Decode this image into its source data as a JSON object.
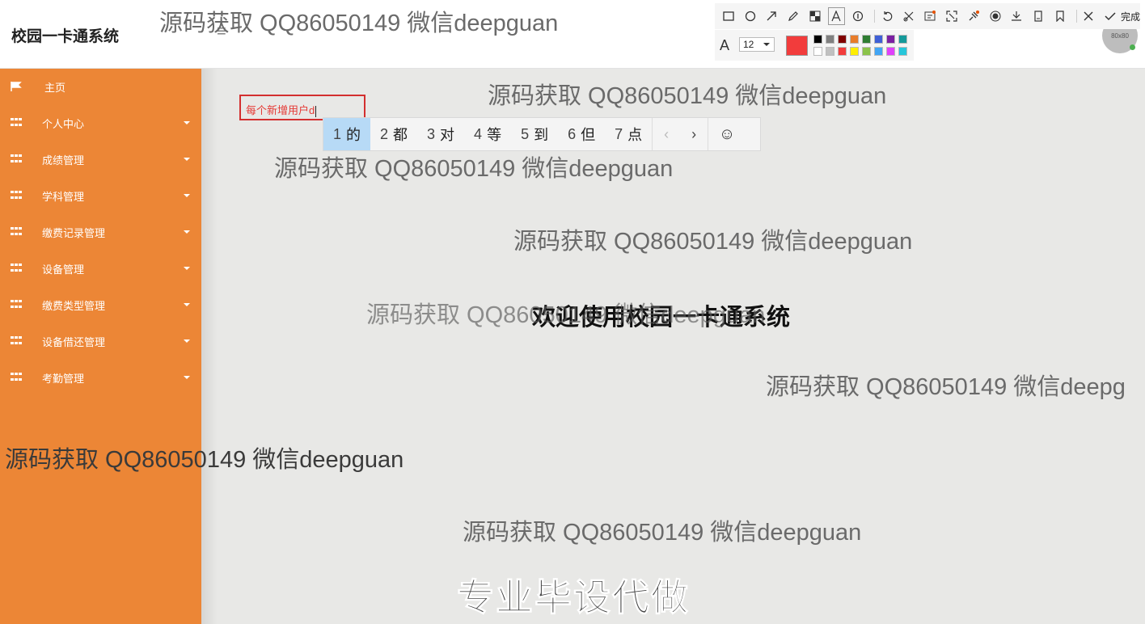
{
  "header": {
    "app_title": "校园一卡通系统",
    "menu_toggle": "≡",
    "avatar_text": "80x80"
  },
  "sidebar": {
    "items": [
      {
        "label": "主页",
        "icon": "flag-icon",
        "has_caret": false
      },
      {
        "label": "个人中心",
        "icon": "grid-icon",
        "has_caret": true
      },
      {
        "label": "成绩管理",
        "icon": "grid-icon",
        "has_caret": true
      },
      {
        "label": "学科管理",
        "icon": "grid-icon",
        "has_caret": true
      },
      {
        "label": "缴费记录管理",
        "icon": "grid-icon",
        "has_caret": true
      },
      {
        "label": "设备管理",
        "icon": "grid-icon",
        "has_caret": true
      },
      {
        "label": "缴费类型管理",
        "icon": "grid-icon",
        "has_caret": true
      },
      {
        "label": "设备借还管理",
        "icon": "grid-icon",
        "has_caret": true
      },
      {
        "label": "考勤管理",
        "icon": "grid-icon",
        "has_caret": true
      }
    ]
  },
  "main": {
    "welcome": "欢迎使用校园一卡通系统",
    "watermark": "源码获取 QQ86050149 微信deepguan",
    "watermark_cut": "源码获取 QQ86050149 微信deepg",
    "promo": "专业毕设代做"
  },
  "annotation": {
    "text": "每个新增用户d",
    "border_color": "#d32f2f"
  },
  "ime": {
    "candidates": [
      {
        "num": "1",
        "text": "的"
      },
      {
        "num": "2",
        "text": "都"
      },
      {
        "num": "3",
        "text": "对"
      },
      {
        "num": "4",
        "text": "等"
      },
      {
        "num": "5",
        "text": "到"
      },
      {
        "num": "6",
        "text": "但"
      },
      {
        "num": "7",
        "text": "点"
      }
    ],
    "prev": "‹",
    "next": "›",
    "emoji": "☺"
  },
  "screenshot_tool": {
    "tools": [
      "rectangle-icon",
      "ellipse-icon",
      "arrow-icon",
      "pencil-icon",
      "mosaic-icon",
      "text-icon",
      "number-icon",
      "undo-icon",
      "delete-icon",
      "ocr-icon",
      "translate-icon",
      "pin-icon",
      "record-icon",
      "download-icon",
      "save-icon",
      "bookmark-icon",
      "close-icon",
      "done-icon"
    ],
    "done_label": "完成",
    "font_size": "12",
    "current_color": "#f23c3c",
    "palette_top": [
      "#000000",
      "#808080",
      "#800000",
      "#e87c2a",
      "#2e7d32",
      "#3f5fd6",
      "#7b1fa2",
      "#14999a"
    ],
    "palette_bottom": [
      "#ffffff",
      "#c0c0c0",
      "#f23c3c",
      "#ffee00",
      "#8bc34a",
      "#42a5f5",
      "#e040fb",
      "#26c6da"
    ]
  },
  "colors": {
    "sidebar_bg": "#ec8636",
    "main_bg": "#e8e8e6"
  }
}
